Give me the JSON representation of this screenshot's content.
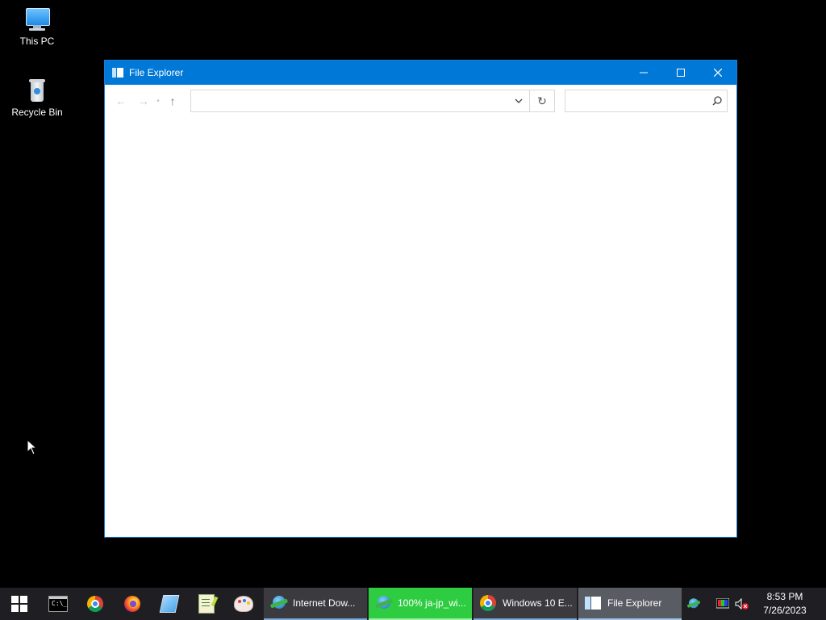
{
  "desktop": {
    "icons": [
      {
        "label": "This PC",
        "icon": "this-pc-icon"
      },
      {
        "label": "Recycle Bin",
        "icon": "recycle-bin-icon"
      }
    ]
  },
  "window": {
    "title": "File Explorer",
    "controls": {
      "minimize": "—",
      "maximize": "☐",
      "close": "✕"
    },
    "toolbar": {
      "back": "←",
      "forward": "→",
      "up": "↑",
      "address_value": "",
      "address_placeholder": "",
      "search_value": "",
      "search_placeholder": "",
      "refresh": "↻",
      "dropdown": "⌄",
      "search_icon": "⌕"
    }
  },
  "taskbar": {
    "pinned": [
      {
        "name": "command-prompt-icon",
        "title": "Command Prompt"
      },
      {
        "name": "chrome-icon",
        "title": "Google Chrome"
      },
      {
        "name": "firefox-icon",
        "title": "Firefox"
      },
      {
        "name": "notepad-icon",
        "title": "Notepad"
      },
      {
        "name": "notepad-plus-plus-icon",
        "title": "Notepad++"
      },
      {
        "name": "paint-icon",
        "title": "Paint"
      }
    ],
    "tasks": [
      {
        "label": "Internet Dow...",
        "icon": "idm-icon"
      },
      {
        "label": "100% ja-jp_wi...",
        "icon": "idm-icon"
      },
      {
        "label": "Windows 10 E...",
        "icon": "chrome-icon"
      },
      {
        "label": "File Explorer",
        "icon": "file-explorer-icon"
      }
    ],
    "clock": {
      "time": "8:53 PM",
      "date": "7/26/2023"
    }
  },
  "colors": {
    "accent": "#0078d7",
    "taskbar": "#1f1f23",
    "download_task": "#2ecc40",
    "desktop": "#000000"
  }
}
